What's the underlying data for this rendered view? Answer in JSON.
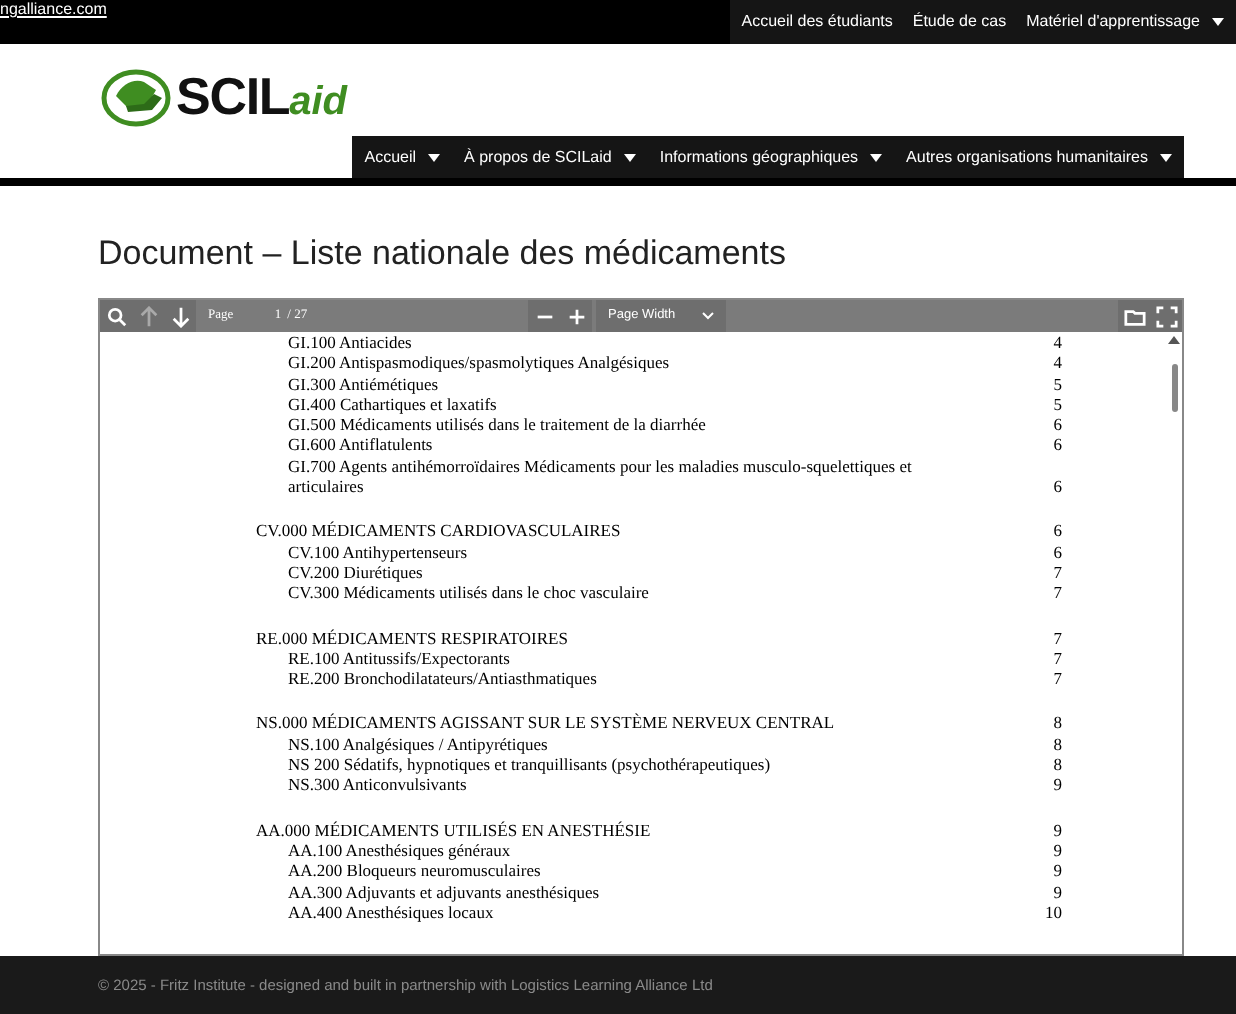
{
  "top_bar": {
    "link": "ngalliance.com",
    "menu": [
      {
        "label": "Accueil des étudiants",
        "has_dropdown": false
      },
      {
        "label": "Étude de cas",
        "has_dropdown": false
      },
      {
        "label": "Matériel d'apprentissage",
        "has_dropdown": true
      }
    ]
  },
  "logo": {
    "bold": "SCIL",
    "accent": "aid"
  },
  "nav": [
    {
      "label": "Accueil",
      "has_dropdown": true
    },
    {
      "label": "À propos de SCILaid",
      "has_dropdown": true
    },
    {
      "label": "Informations géographiques",
      "has_dropdown": true
    },
    {
      "label": "Autres organisations humanitaires",
      "has_dropdown": true
    }
  ],
  "page_title": "Document – Liste nationale des médicaments",
  "viewer": {
    "toolbar": {
      "previous_disabled": true,
      "page_label": "Page",
      "page_value": "1",
      "page_total": "/ 27",
      "zoom": "Page Width"
    },
    "sections": [
      {
        "items": [
          {
            "text": "GI.100 Antiacides",
            "page": "4"
          },
          {
            "text": "GI.200 Antispasmodiques/spasmolytiques Analgésiques",
            "page": "4"
          },
          {
            "text": "GI.300 Antiémétiques",
            "page": "5"
          },
          {
            "text": "GI.400 Cathartiques et laxatifs",
            "page": "5"
          },
          {
            "text": "GI.500 Médicaments utilisés dans le traitement de la diarrhée",
            "page": "6"
          },
          {
            "text": "GI.600 Antiflatulents",
            "page": "6"
          },
          {
            "text": "GI.700 Agents antihémorroïdaires Médicaments pour les maladies musculo-squelettiques et articulaires",
            "page": "6"
          }
        ]
      },
      {
        "heading": {
          "text": "CV.000 MÉDICAMENTS CARDIOVASCULAIRES",
          "page": "6"
        },
        "items": [
          {
            "text": "CV.100 Antihypertenseurs",
            "page": "6"
          },
          {
            "text": "CV.200 Diurétiques",
            "page": "7"
          },
          {
            "text": "CV.300 Médicaments utilisés dans le choc vasculaire",
            "page": "7"
          }
        ]
      },
      {
        "heading": {
          "text": "RE.000 MÉDICAMENTS RESPIRATOIRES",
          "page": "7"
        },
        "items": [
          {
            "text": "RE.100 Antitussifs/Expectorants",
            "page": "7"
          },
          {
            "text": "RE.200 Bronchodilatateurs/Antiasthmatiques",
            "page": "7"
          }
        ]
      },
      {
        "heading": {
          "text": "NS.000 MÉDICAMENTS AGISSANT SUR LE SYSTÈME NERVEUX CENTRAL",
          "page": "8"
        },
        "items": [
          {
            "text": "NS.100 Analgésiques / Antipyrétiques",
            "page": "8"
          },
          {
            "text": "NS 200 Sédatifs, hypnotiques et tranquillisants (psychothérapeutiques)",
            "page": "8"
          },
          {
            "text": "NS.300 Anticonvulsivants",
            "page": "9"
          }
        ]
      },
      {
        "heading": {
          "text": "AA.000 MÉDICAMENTS UTILISÉS EN ANESTHÉSIE",
          "page": "9"
        },
        "items": [
          {
            "text": "AA.100 Anesthésiques généraux",
            "page": "9"
          },
          {
            "text": "AA.200 Bloqueurs neuromusculaires",
            "page": "9"
          },
          {
            "text": "AA.300 Adjuvants et adjuvants anesthésiques",
            "page": "9"
          },
          {
            "text": "AA.400 Anesthésiques locaux",
            "page": "10"
          }
        ]
      }
    ]
  },
  "footer": "© 2025 - Fritz Institute - designed and built in partnership with Logistics Learning Alliance Ltd"
}
